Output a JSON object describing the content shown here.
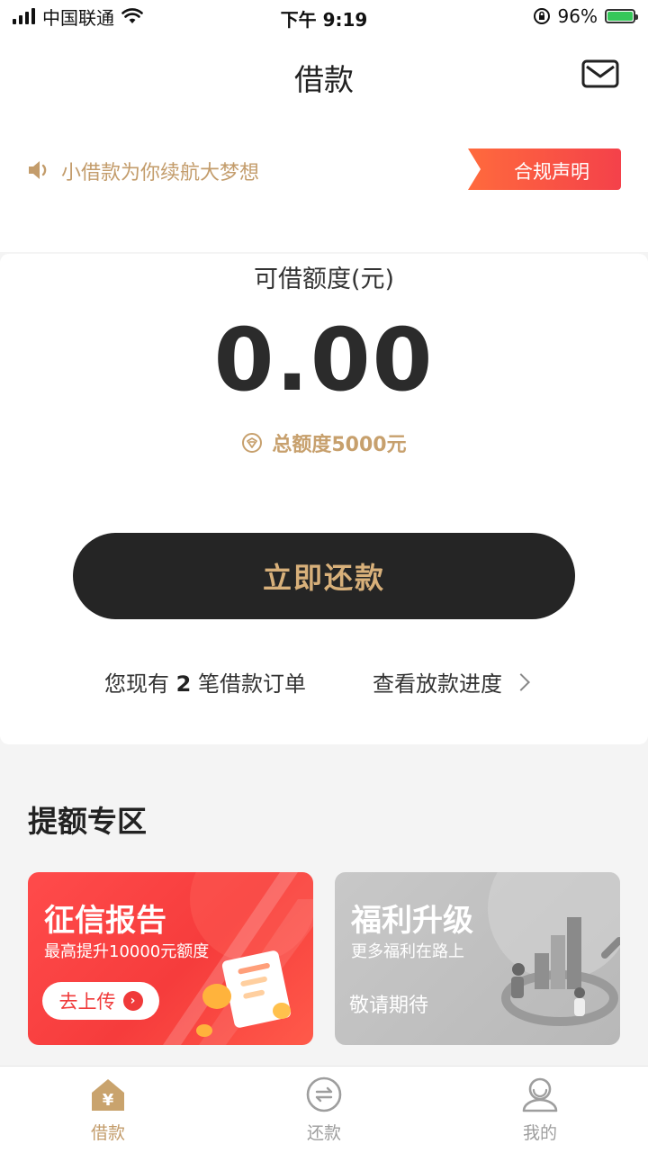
{
  "status_bar": {
    "carrier": "中国联通",
    "time": "下午 9:19",
    "battery": "96%"
  },
  "header": {
    "title": "借款",
    "mail_icon": "mail-icon"
  },
  "notice": {
    "text": "小借款为你续航大梦想",
    "compliance_label": "合规声明"
  },
  "credit": {
    "available_label": "可借额度(元)",
    "available_amount": "0.00",
    "total_label": "总额度5000元",
    "repay_button": "立即还款",
    "orders_prefix": "您现有",
    "orders_count": "2",
    "orders_suffix": "笔借款订单",
    "progress_link": "查看放款进度"
  },
  "section": {
    "title": "提额专区",
    "cards": [
      {
        "title": "征信报告",
        "subtitle": "最高提升10000元额度",
        "action": "去上传"
      },
      {
        "title": "福利升级",
        "subtitle": "更多福利在路上",
        "action": "敬请期待"
      }
    ]
  },
  "tabs": [
    {
      "label": "借款",
      "icon": "home-yuan-icon",
      "active": true
    },
    {
      "label": "还款",
      "icon": "repay-exchange-icon",
      "active": false
    },
    {
      "label": "我的",
      "icon": "profile-icon",
      "active": false
    }
  ],
  "colors": {
    "accent_gold": "#c7a06d",
    "button_dark": "#252525",
    "promo_red": "#f63c3c"
  }
}
